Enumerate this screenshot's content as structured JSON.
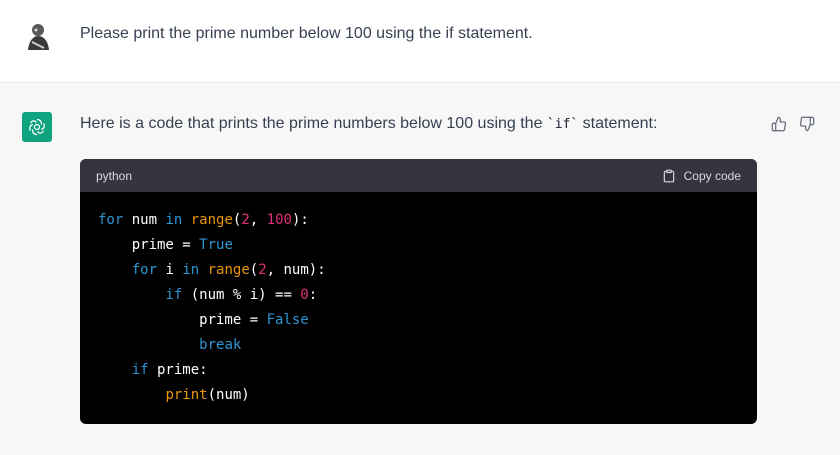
{
  "user_message": {
    "text": "Please print the prime number below 100 using the if statement."
  },
  "assistant_message": {
    "intro_before": "Here is a code that prints the prime numbers below 100 using the ",
    "intro_code": "`if`",
    "intro_after": " statement:",
    "code_block": {
      "language": "python",
      "copy_label": "Copy code",
      "lines": [
        [
          {
            "t": "for",
            "c": "kw"
          },
          {
            "t": " num ",
            "c": "plain"
          },
          {
            "t": "in",
            "c": "kw"
          },
          {
            "t": " ",
            "c": "plain"
          },
          {
            "t": "range",
            "c": "fn"
          },
          {
            "t": "(",
            "c": "plain"
          },
          {
            "t": "2",
            "c": "num"
          },
          {
            "t": ", ",
            "c": "plain"
          },
          {
            "t": "100",
            "c": "num"
          },
          {
            "t": "):",
            "c": "plain"
          }
        ],
        [
          {
            "t": "    prime = ",
            "c": "plain"
          },
          {
            "t": "True",
            "c": "bool"
          }
        ],
        [
          {
            "t": "    ",
            "c": "plain"
          },
          {
            "t": "for",
            "c": "kw"
          },
          {
            "t": " i ",
            "c": "plain"
          },
          {
            "t": "in",
            "c": "kw"
          },
          {
            "t": " ",
            "c": "plain"
          },
          {
            "t": "range",
            "c": "fn"
          },
          {
            "t": "(",
            "c": "plain"
          },
          {
            "t": "2",
            "c": "num"
          },
          {
            "t": ", num):",
            "c": "plain"
          }
        ],
        [
          {
            "t": "        ",
            "c": "plain"
          },
          {
            "t": "if",
            "c": "kw"
          },
          {
            "t": " (num % i) == ",
            "c": "plain"
          },
          {
            "t": "0",
            "c": "num"
          },
          {
            "t": ":",
            "c": "plain"
          }
        ],
        [
          {
            "t": "            prime = ",
            "c": "plain"
          },
          {
            "t": "False",
            "c": "bool"
          }
        ],
        [
          {
            "t": "            ",
            "c": "plain"
          },
          {
            "t": "break",
            "c": "kw"
          }
        ],
        [
          {
            "t": "    ",
            "c": "plain"
          },
          {
            "t": "if",
            "c": "kw"
          },
          {
            "t": " prime:",
            "c": "plain"
          }
        ],
        [
          {
            "t": "        ",
            "c": "plain"
          },
          {
            "t": "print",
            "c": "fn"
          },
          {
            "t": "(num)",
            "c": "plain"
          }
        ]
      ]
    }
  },
  "icons": {
    "user_avatar": "user-avatar-photo",
    "assistant_avatar": "openai-logo-icon",
    "thumbs_up": "thumbs-up-icon",
    "thumbs_down": "thumbs-down-icon",
    "copy": "clipboard-icon"
  },
  "colors": {
    "assistant_bg": "#f7f7f8",
    "avatar_green": "#10a37f",
    "code_bg": "#000000",
    "code_header_bg": "#343541",
    "keyword": "#2e95d3",
    "function": "#e9950c",
    "number": "#df3079"
  }
}
